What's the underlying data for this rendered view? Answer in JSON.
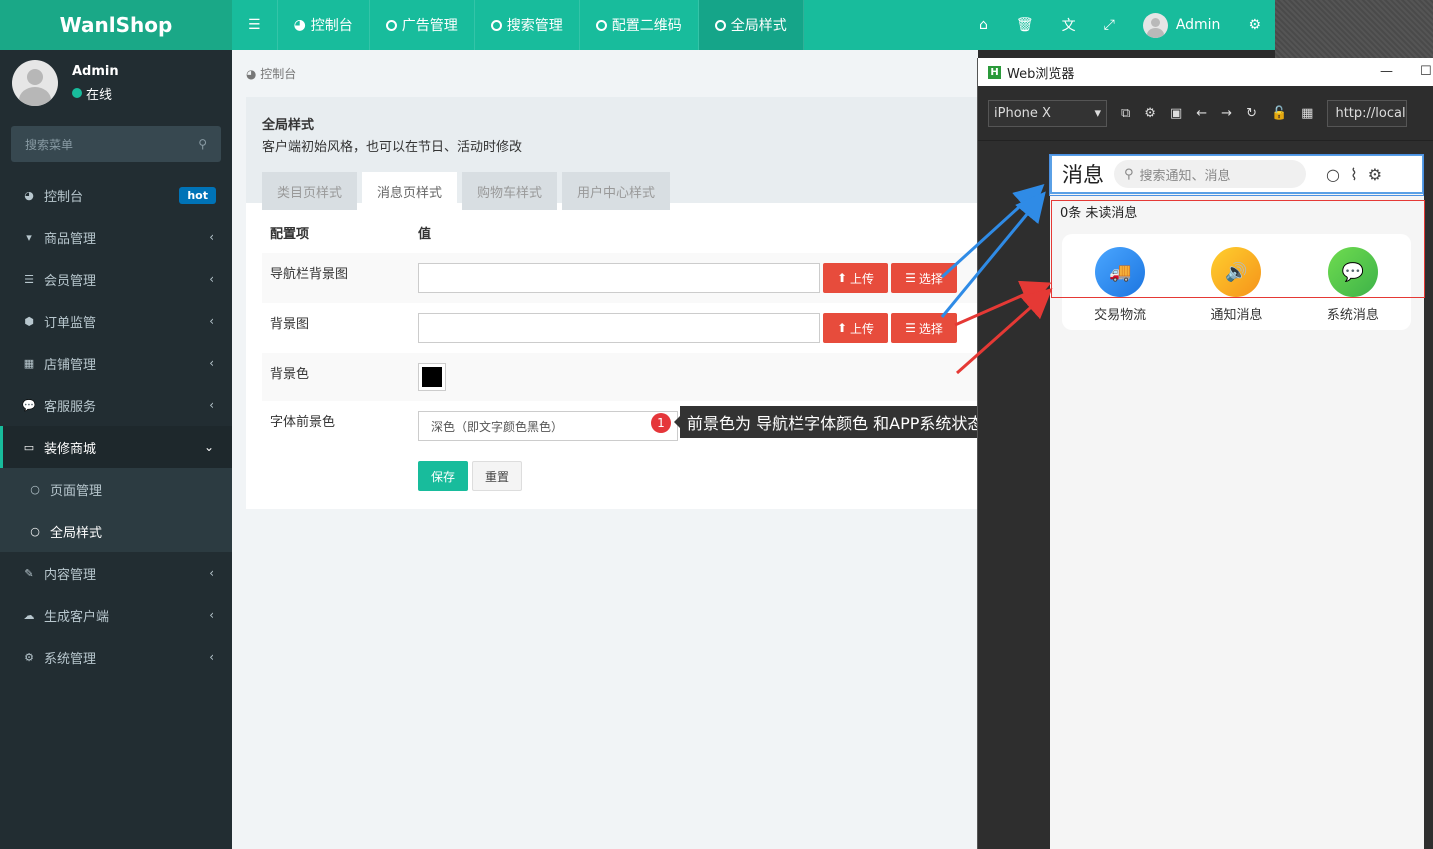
{
  "app": {
    "logo": "WanlShop"
  },
  "topnav": {
    "menu_icon": "bars-icon",
    "items": [
      {
        "label": "控制台",
        "icon": "dashboard-icon"
      },
      {
        "label": "广告管理",
        "icon": "circle-icon"
      },
      {
        "label": "搜索管理",
        "icon": "circle-icon"
      },
      {
        "label": "配置二维码",
        "icon": "circle-icon"
      },
      {
        "label": "全局样式",
        "icon": "circle-icon",
        "active": true
      }
    ],
    "right": {
      "user": "Admin"
    }
  },
  "sidebar": {
    "user": {
      "name": "Admin",
      "status": "在线"
    },
    "search_placeholder": "搜索菜单",
    "items": [
      {
        "label": "控制台",
        "badge": "hot"
      },
      {
        "label": "商品管理"
      },
      {
        "label": "会员管理"
      },
      {
        "label": "订单监管"
      },
      {
        "label": "店铺管理"
      },
      {
        "label": "客服服务"
      },
      {
        "label": "装修商城",
        "open": true
      },
      {
        "label": "页面管理"
      },
      {
        "label": "全局样式",
        "current": true
      },
      {
        "label": "内容管理"
      },
      {
        "label": "生成客户端"
      },
      {
        "label": "系统管理"
      }
    ]
  },
  "content": {
    "breadcrumb": "控制台",
    "panel": {
      "title": "全局样式",
      "desc": "客户端初始风格，也可以在节日、活动时修改",
      "tabs": [
        "类目页样式",
        "消息页样式",
        "购物车样式",
        "用户中心样式"
      ],
      "active_tab": "消息页样式"
    },
    "table": {
      "headers": [
        "配置项",
        "值"
      ],
      "rows": [
        {
          "label": "导航栏背景图"
        },
        {
          "label": "背景图"
        },
        {
          "label": "背景色"
        },
        {
          "label": "字体前景色",
          "select_value": "深色（即文字颜色黑色）"
        }
      ],
      "upload_label": "上传",
      "choose_label": "选择",
      "save_label": "保存",
      "reset_label": "重置",
      "bg_color": "#000000"
    },
    "tooltip": {
      "badge": "1",
      "text": "前景色为 导航栏字体颜色 和APP系统状态栏 颜色"
    }
  },
  "browser": {
    "title": "Web浏览器",
    "device": "iPhone X",
    "url": "http://localh",
    "phone": {
      "nav_title": "消息",
      "search_placeholder": "搜索通知、消息",
      "unread": "0条 未读消息",
      "items": [
        {
          "label": "交易物流",
          "color": "#2a8ef0"
        },
        {
          "label": "通知消息",
          "color": "#f7a21a"
        },
        {
          "label": "系统消息",
          "color": "#4cc24e"
        }
      ]
    }
  },
  "colors": {
    "primary": "#18bc9c",
    "sidebar": "#222d32",
    "danger": "#e74c3c",
    "arrow_blue": "#2f8be6",
    "arrow_red": "#e53935"
  }
}
